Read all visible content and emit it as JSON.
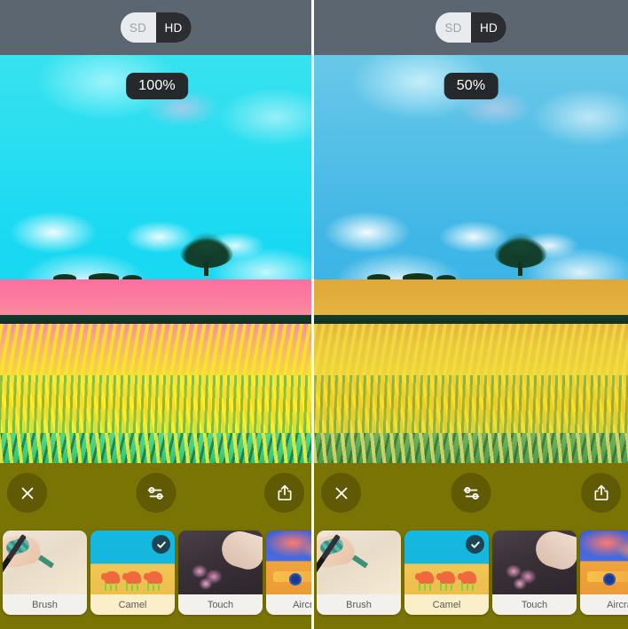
{
  "panels": [
    {
      "id": "left-panel",
      "quality_toggle": {
        "options": [
          "SD",
          "HD"
        ],
        "selected": "HD"
      },
      "intensity_badge": "100%",
      "toolbar": {
        "close_label": "Close",
        "adjust_label": "Adjust",
        "share_label": "Share"
      },
      "styles": [
        {
          "label": "Brush",
          "selected": false
        },
        {
          "label": "Camel",
          "selected": true
        },
        {
          "label": "Touch",
          "selected": false
        },
        {
          "label": "Aircraft",
          "selected": false
        }
      ]
    },
    {
      "id": "right-panel",
      "quality_toggle": {
        "options": [
          "SD",
          "HD"
        ],
        "selected": "HD"
      },
      "intensity_badge": "50%",
      "toolbar": {
        "close_label": "Close",
        "adjust_label": "Adjust",
        "share_label": "Share"
      },
      "styles": [
        {
          "label": "Brush",
          "selected": false
        },
        {
          "label": "Camel",
          "selected": true
        },
        {
          "label": "Touch",
          "selected": false
        },
        {
          "label": "Aircraft",
          "selected": false
        }
      ]
    }
  ],
  "icons": {
    "close": "close-icon",
    "adjust": "sliders-icon",
    "share": "share-icon",
    "check": "check-icon"
  },
  "colors": {
    "header_bg": "#5c6670",
    "toolbar_bg": "#7a7405",
    "segment_active_bg": "#2b2d30",
    "segment_inactive_bg": "#e9ecef",
    "badge_bg": "#26292b",
    "check_badge_bg": "#1d4453"
  }
}
